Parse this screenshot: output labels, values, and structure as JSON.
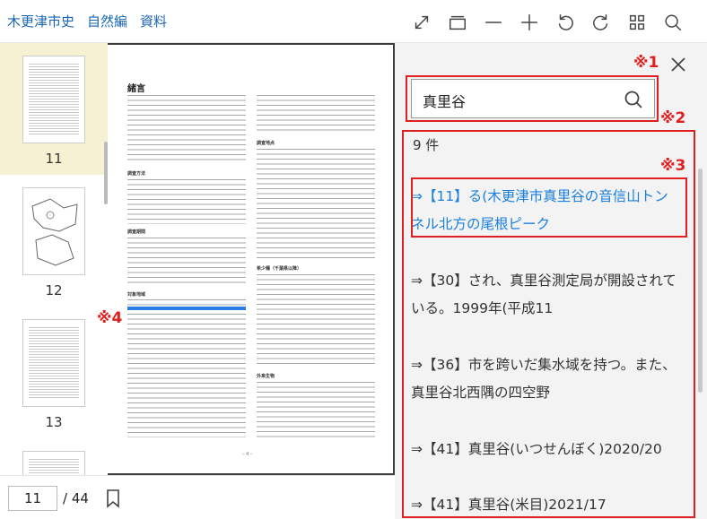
{
  "breadcrumbs": [
    "木更津市史",
    "自然編",
    "資料"
  ],
  "toolbar_icons": [
    "fullscreen-icon",
    "layers-icon",
    "zoom-out-icon",
    "zoom-in-icon",
    "rotate-left-icon",
    "rotate-right-icon",
    "grid-icon",
    "search-icon"
  ],
  "thumbnails": [
    {
      "num": "11",
      "selected": true
    },
    {
      "num": "12",
      "selected": false
    },
    {
      "num": "13",
      "selected": false
    }
  ],
  "pagenav": {
    "current": "11",
    "total": "/ 44"
  },
  "document": {
    "heading": "緒言",
    "sections": [
      "調査方法",
      "調査期間",
      "対象地域",
      "調査地点",
      "希少種（千葉県以降）",
      "外来生物"
    ],
    "footer": "– 4 –"
  },
  "search": {
    "value": "真里谷",
    "count": "9 件"
  },
  "results": [
    "⇒【11】る(木更津市真里谷の音信山トンネル北方の尾根ピーク",
    "⇒【30】され、真里谷測定局が開設されている。1999年(平成11",
    "⇒【36】市を跨いだ集水域を持つ。また、真里谷北西隅の四空野",
    "⇒【41】真里谷(いつせんぼく)2020/20",
    "⇒【41】真里谷(米目)2021/17"
  ],
  "annotations": {
    "m1": "※1",
    "m2": "※2",
    "m3": "※3",
    "m4": "※4"
  },
  "colors": {
    "accent": "#1a7fe0",
    "annotation": "#e02020",
    "selected_thumb": "#f6f1d2"
  }
}
